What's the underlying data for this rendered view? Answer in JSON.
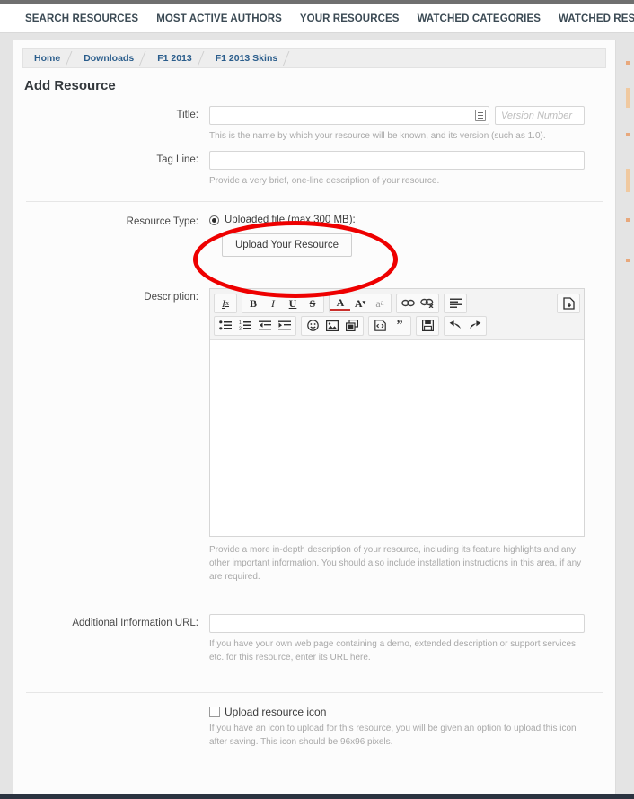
{
  "nav": {
    "items": [
      {
        "label": "SEARCH RESOURCES",
        "name": "search-resources"
      },
      {
        "label": "MOST ACTIVE AUTHORS",
        "name": "most-active-authors"
      },
      {
        "label": "YOUR RESOURCES",
        "name": "your-resources"
      },
      {
        "label": "WATCHED CATEGORIES",
        "name": "watched-categories"
      },
      {
        "label": "WATCHED RESOURCES",
        "name": "watched-resources"
      }
    ]
  },
  "breadcrumb": {
    "items": [
      {
        "label": "Home"
      },
      {
        "label": "Downloads"
      },
      {
        "label": "F1 2013"
      },
      {
        "label": "F1 2013 Skins"
      }
    ]
  },
  "page": {
    "title": "Add Resource"
  },
  "form": {
    "title_field": {
      "label": "Title:",
      "value": "",
      "placeholder": "",
      "version_value": "",
      "version_placeholder": "Version Number",
      "hint": "This is the name by which your resource will be known, and its version (such as 1.0)."
    },
    "tagline_field": {
      "label": "Tag Line:",
      "value": "",
      "placeholder": "",
      "hint": "Provide a very brief, one-line description of your resource."
    },
    "resource_type": {
      "label": "Resource Type:",
      "radio_label": "Uploaded file (max 300 MB):",
      "radio_selected": true,
      "upload_button": "Upload Your Resource"
    },
    "description_field": {
      "label": "Description:",
      "value": "",
      "hint": "Provide a more in-depth description of your resource, including its feature highlights and any other important information. You should also include installation instructions in this area, if any are required."
    },
    "url_field": {
      "label": "Additional Information URL:",
      "value": "",
      "placeholder": "",
      "hint": "If you have your own web page containing a demo, extended description or support services etc. for this resource, enter its URL here."
    },
    "icon_field": {
      "checkbox_label": "Upload resource icon",
      "checked": false,
      "hint": "If you have an icon to upload for this resource, you will be given an option to upload this icon after saving. This icon should be 96x96 pixels."
    }
  },
  "editor_toolbar": {
    "row1": [
      {
        "group": 1,
        "name": "remove-format-icon",
        "glyph": "Iₓ"
      },
      {
        "group": 2,
        "name": "bold-icon",
        "glyph": "B"
      },
      {
        "group": 2,
        "name": "italic-icon",
        "glyph": "I"
      },
      {
        "group": 2,
        "name": "underline-icon",
        "glyph": "U"
      },
      {
        "group": 2,
        "name": "strikethrough-icon",
        "glyph": "S"
      },
      {
        "group": 3,
        "name": "text-color-icon",
        "glyph": "A"
      },
      {
        "group": 3,
        "name": "font-size-icon",
        "glyph": "A·"
      },
      {
        "group": 3,
        "name": "font-family-icon",
        "glyph": "aₐ"
      },
      {
        "group": 4,
        "name": "insert-link-icon",
        "glyph": "∞"
      },
      {
        "group": 4,
        "name": "remove-link-icon",
        "glyph": "∞"
      },
      {
        "group": 5,
        "name": "align-icon",
        "glyph": "≡"
      },
      {
        "group": 6,
        "name": "toggle-source-icon",
        "glyph": "⎘"
      }
    ],
    "row2": [
      {
        "group": 1,
        "name": "bullet-list-icon"
      },
      {
        "group": 1,
        "name": "numbered-list-icon"
      },
      {
        "group": 1,
        "name": "outdent-icon"
      },
      {
        "group": 1,
        "name": "indent-icon"
      },
      {
        "group": 2,
        "name": "smilie-icon"
      },
      {
        "group": 2,
        "name": "insert-image-icon"
      },
      {
        "group": 2,
        "name": "insert-media-icon"
      },
      {
        "group": 3,
        "name": "insert-code-icon"
      },
      {
        "group": 3,
        "name": "insert-quote-icon"
      },
      {
        "group": 4,
        "name": "save-draft-icon"
      },
      {
        "group": 5,
        "name": "undo-icon"
      },
      {
        "group": 5,
        "name": "redo-icon"
      }
    ]
  },
  "annotation": {
    "shape": "ellipse",
    "color": "#ee0000",
    "target": "upload-your-resource-button"
  },
  "colors": {
    "nav_text": "#3b4a54",
    "crumb_link": "#2a5d8c",
    "hint_text": "#a8a8a8",
    "panel_bg": "#fcfcfc",
    "page_bg": "#e4e4e4",
    "annotation_red": "#ee0000"
  }
}
